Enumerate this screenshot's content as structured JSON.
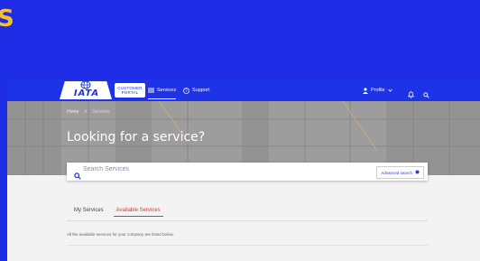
{
  "background_letter": "S",
  "colors": {
    "brand_blue": "#1e32e6",
    "slide_bg": "#1e2ce6",
    "accent_yellow": "#f5c02a",
    "active_tab": "#e2372b"
  },
  "header": {
    "logo_text": "IATA",
    "portal_line1": "CUSTOMER",
    "portal_line2": "PORTAL",
    "nav": {
      "services_label": "Services",
      "support_label": "Support",
      "profile_label": "Profile"
    },
    "icons": [
      "services-icon",
      "support-icon",
      "person-icon",
      "bell-icon",
      "search-icon"
    ]
  },
  "hero": {
    "breadcrumb": {
      "home": "Home",
      "separator": ">",
      "current": "Services"
    },
    "title": "Looking for a service?",
    "search": {
      "placeholder": "Search Services",
      "advanced_label": "Advanced search"
    }
  },
  "tabs": [
    {
      "label": "My Services",
      "active": false
    },
    {
      "label": "Available Services",
      "active": true
    }
  ],
  "info_text": "All the available services for your company are listed below."
}
